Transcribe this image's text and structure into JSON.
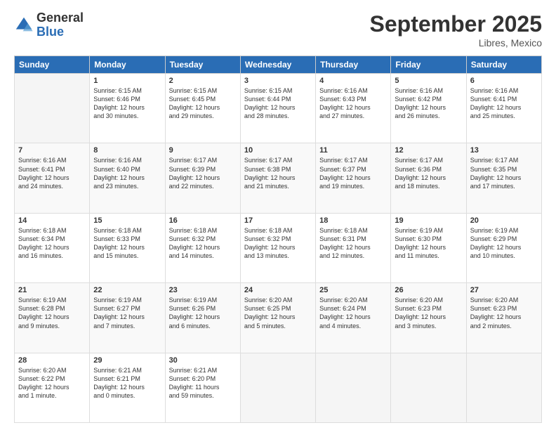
{
  "logo": {
    "general": "General",
    "blue": "Blue"
  },
  "header": {
    "month": "September 2025",
    "location": "Libres, Mexico"
  },
  "weekdays": [
    "Sunday",
    "Monday",
    "Tuesday",
    "Wednesday",
    "Thursday",
    "Friday",
    "Saturday"
  ],
  "weeks": [
    [
      {
        "day": "",
        "info": ""
      },
      {
        "day": "1",
        "info": "Sunrise: 6:15 AM\nSunset: 6:46 PM\nDaylight: 12 hours\nand 30 minutes."
      },
      {
        "day": "2",
        "info": "Sunrise: 6:15 AM\nSunset: 6:45 PM\nDaylight: 12 hours\nand 29 minutes."
      },
      {
        "day": "3",
        "info": "Sunrise: 6:15 AM\nSunset: 6:44 PM\nDaylight: 12 hours\nand 28 minutes."
      },
      {
        "day": "4",
        "info": "Sunrise: 6:16 AM\nSunset: 6:43 PM\nDaylight: 12 hours\nand 27 minutes."
      },
      {
        "day": "5",
        "info": "Sunrise: 6:16 AM\nSunset: 6:42 PM\nDaylight: 12 hours\nand 26 minutes."
      },
      {
        "day": "6",
        "info": "Sunrise: 6:16 AM\nSunset: 6:41 PM\nDaylight: 12 hours\nand 25 minutes."
      }
    ],
    [
      {
        "day": "7",
        "info": "Sunrise: 6:16 AM\nSunset: 6:41 PM\nDaylight: 12 hours\nand 24 minutes."
      },
      {
        "day": "8",
        "info": "Sunrise: 6:16 AM\nSunset: 6:40 PM\nDaylight: 12 hours\nand 23 minutes."
      },
      {
        "day": "9",
        "info": "Sunrise: 6:17 AM\nSunset: 6:39 PM\nDaylight: 12 hours\nand 22 minutes."
      },
      {
        "day": "10",
        "info": "Sunrise: 6:17 AM\nSunset: 6:38 PM\nDaylight: 12 hours\nand 21 minutes."
      },
      {
        "day": "11",
        "info": "Sunrise: 6:17 AM\nSunset: 6:37 PM\nDaylight: 12 hours\nand 19 minutes."
      },
      {
        "day": "12",
        "info": "Sunrise: 6:17 AM\nSunset: 6:36 PM\nDaylight: 12 hours\nand 18 minutes."
      },
      {
        "day": "13",
        "info": "Sunrise: 6:17 AM\nSunset: 6:35 PM\nDaylight: 12 hours\nand 17 minutes."
      }
    ],
    [
      {
        "day": "14",
        "info": "Sunrise: 6:18 AM\nSunset: 6:34 PM\nDaylight: 12 hours\nand 16 minutes."
      },
      {
        "day": "15",
        "info": "Sunrise: 6:18 AM\nSunset: 6:33 PM\nDaylight: 12 hours\nand 15 minutes."
      },
      {
        "day": "16",
        "info": "Sunrise: 6:18 AM\nSunset: 6:32 PM\nDaylight: 12 hours\nand 14 minutes."
      },
      {
        "day": "17",
        "info": "Sunrise: 6:18 AM\nSunset: 6:32 PM\nDaylight: 12 hours\nand 13 minutes."
      },
      {
        "day": "18",
        "info": "Sunrise: 6:18 AM\nSunset: 6:31 PM\nDaylight: 12 hours\nand 12 minutes."
      },
      {
        "day": "19",
        "info": "Sunrise: 6:19 AM\nSunset: 6:30 PM\nDaylight: 12 hours\nand 11 minutes."
      },
      {
        "day": "20",
        "info": "Sunrise: 6:19 AM\nSunset: 6:29 PM\nDaylight: 12 hours\nand 10 minutes."
      }
    ],
    [
      {
        "day": "21",
        "info": "Sunrise: 6:19 AM\nSunset: 6:28 PM\nDaylight: 12 hours\nand 9 minutes."
      },
      {
        "day": "22",
        "info": "Sunrise: 6:19 AM\nSunset: 6:27 PM\nDaylight: 12 hours\nand 7 minutes."
      },
      {
        "day": "23",
        "info": "Sunrise: 6:19 AM\nSunset: 6:26 PM\nDaylight: 12 hours\nand 6 minutes."
      },
      {
        "day": "24",
        "info": "Sunrise: 6:20 AM\nSunset: 6:25 PM\nDaylight: 12 hours\nand 5 minutes."
      },
      {
        "day": "25",
        "info": "Sunrise: 6:20 AM\nSunset: 6:24 PM\nDaylight: 12 hours\nand 4 minutes."
      },
      {
        "day": "26",
        "info": "Sunrise: 6:20 AM\nSunset: 6:23 PM\nDaylight: 12 hours\nand 3 minutes."
      },
      {
        "day": "27",
        "info": "Sunrise: 6:20 AM\nSunset: 6:23 PM\nDaylight: 12 hours\nand 2 minutes."
      }
    ],
    [
      {
        "day": "28",
        "info": "Sunrise: 6:20 AM\nSunset: 6:22 PM\nDaylight: 12 hours\nand 1 minute."
      },
      {
        "day": "29",
        "info": "Sunrise: 6:21 AM\nSunset: 6:21 PM\nDaylight: 12 hours\nand 0 minutes."
      },
      {
        "day": "30",
        "info": "Sunrise: 6:21 AM\nSunset: 6:20 PM\nDaylight: 11 hours\nand 59 minutes."
      },
      {
        "day": "",
        "info": ""
      },
      {
        "day": "",
        "info": ""
      },
      {
        "day": "",
        "info": ""
      },
      {
        "day": "",
        "info": ""
      }
    ]
  ]
}
